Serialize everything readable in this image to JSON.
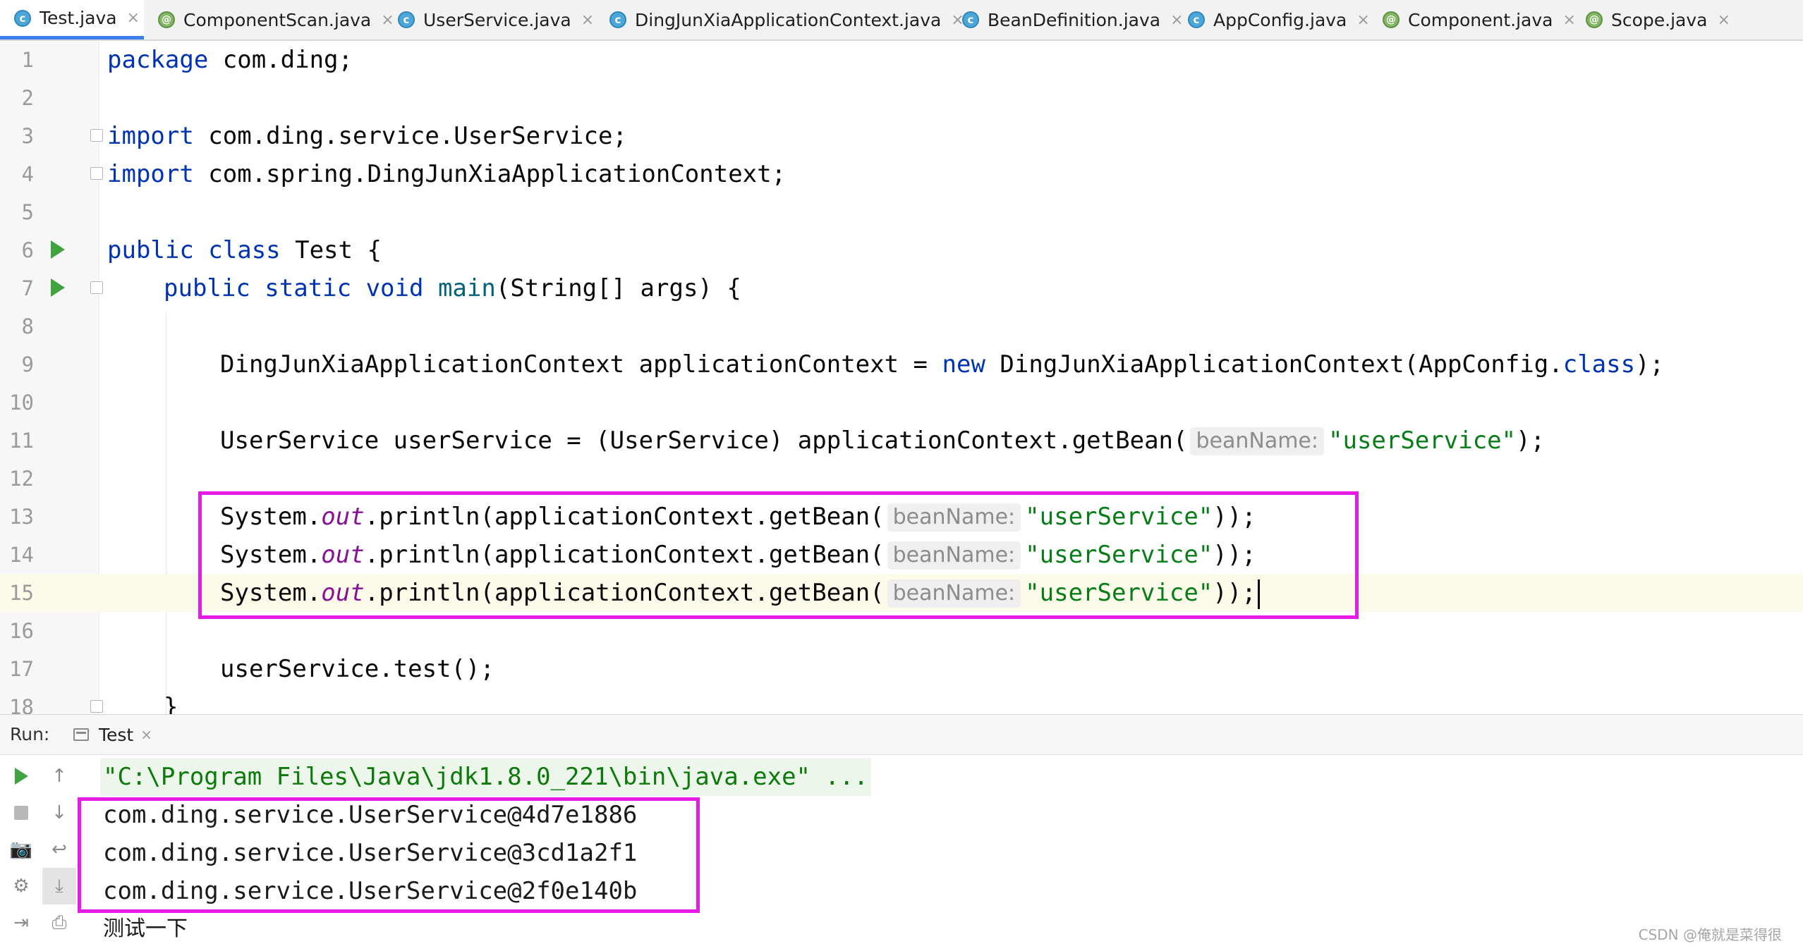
{
  "tabs": [
    {
      "label": "Test.java",
      "icon": "class-icon",
      "active": true
    },
    {
      "label": "ComponentScan.java",
      "icon": "annotation-icon",
      "active": false
    },
    {
      "label": "UserService.java",
      "icon": "class-icon",
      "active": false
    },
    {
      "label": "DingJunXiaApplicationContext.java",
      "icon": "class-icon",
      "active": false
    },
    {
      "label": "BeanDefinition.java",
      "icon": "class-icon",
      "active": false
    },
    {
      "label": "AppConfig.java",
      "icon": "class-icon",
      "active": false
    },
    {
      "label": "Component.java",
      "icon": "annotation-icon",
      "active": false
    },
    {
      "label": "Scope.java",
      "icon": "annotation-icon",
      "active": false
    }
  ],
  "editor": {
    "line_numbers": [
      "1",
      "2",
      "3",
      "4",
      "5",
      "6",
      "7",
      "8",
      "9",
      "10",
      "11",
      "12",
      "13",
      "14",
      "15",
      "16",
      "17",
      "18"
    ],
    "current_line": "15",
    "code": {
      "l1_kw": "package",
      "l1_rest": " com.ding;",
      "l3_kw": "import",
      "l3_rest": " com.ding.service.UserService;",
      "l4_kw": "import",
      "l4_rest": " com.spring.DingJunXiaApplicationContext;",
      "l6_kw": "public class",
      "l6_rest": " Test {",
      "l7_kw": "public static void",
      "l7_fn": "main",
      "l7_rest": "(String[] args) {",
      "l9_a": "DingJunXiaApplicationContext applicationContext = ",
      "l9_kw": "new",
      "l9_b": " DingJunXiaApplicationContext(AppConfig.",
      "l9_kw2": "class",
      "l9_c": ");",
      "l11_a": "UserService userService = (UserService) applicationContext.getBean(",
      "l11_hint": "beanName:",
      "l11_str": "\"userService\"",
      "l11_c": ");",
      "print_a": "System.",
      "print_out": "out",
      "print_b": ".println(applicationContext.getBean(",
      "print_hint": "beanName:",
      "print_str": "\"userService\"",
      "print_c": "));",
      "l17": "userService.test();",
      "l18": "}"
    }
  },
  "run_panel": {
    "label": "Run:",
    "tab_label": "Test",
    "output": [
      "\"C:\\Program Files\\Java\\jdk1.8.0_221\\bin\\java.exe\" ...",
      "com.ding.service.UserService@4d7e1886",
      "com.ding.service.UserService@3cd1a2f1",
      "com.ding.service.UserService@2f0e140b",
      "测试一下"
    ]
  },
  "watermark": "CSDN @俺就是菜得很",
  "colors": {
    "highlight_box": "#e61ce6",
    "keyword": "#0033b3",
    "string": "#067d17",
    "field": "#871094"
  }
}
